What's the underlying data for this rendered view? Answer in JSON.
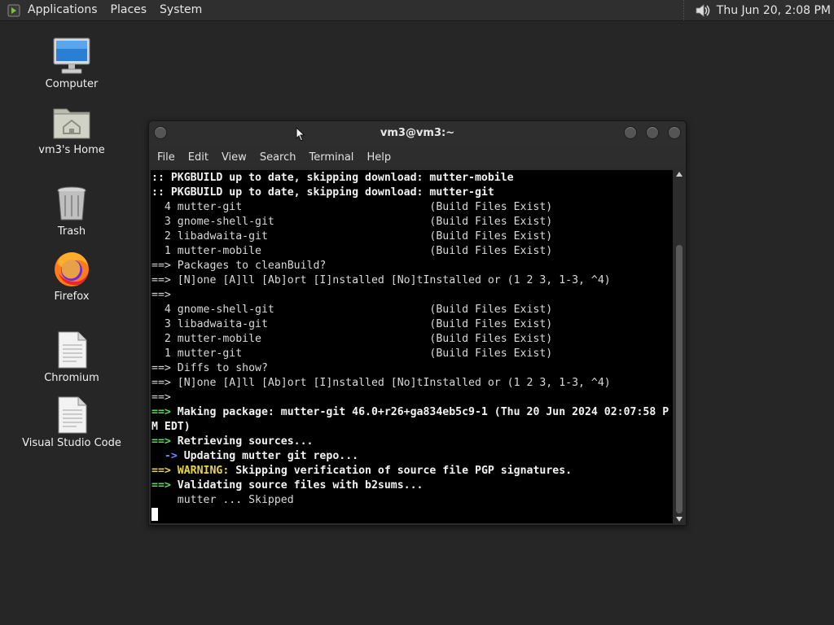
{
  "panel": {
    "menus": [
      "Applications",
      "Places",
      "System"
    ],
    "clock": "Thu Jun 20,  2:08 PM"
  },
  "desktop": {
    "icons": [
      {
        "label": "Computer",
        "icon": "computer-icon"
      },
      {
        "label": "vm3's Home",
        "icon": "home-folder-icon"
      },
      {
        "label": "Trash",
        "icon": "trash-icon"
      },
      {
        "label": "Firefox",
        "icon": "firefox-icon"
      },
      {
        "label": "Chromium",
        "icon": "document-icon"
      },
      {
        "label": "Visual Studio Code",
        "icon": "document-icon"
      }
    ]
  },
  "terminal": {
    "title": "vm3@vm3:~",
    "menus": [
      "File",
      "Edit",
      "View",
      "Search",
      "Terminal",
      "Help"
    ],
    "lines": [
      [
        {
          "t": ":: PKGBUILD up to date, skipping download: mutter-mobile",
          "c": "b"
        }
      ],
      [
        {
          "t": ":: PKGBUILD up to date, skipping download: mutter-git",
          "c": "b"
        }
      ],
      [
        {
          "t": "  4 mutter-git                             (Build Files Exist)",
          "c": ""
        }
      ],
      [
        {
          "t": "  3 gnome-shell-git                        (Build Files Exist)",
          "c": ""
        }
      ],
      [
        {
          "t": "  2 libadwaita-git                         (Build Files Exist)",
          "c": ""
        }
      ],
      [
        {
          "t": "  1 mutter-mobile                          (Build Files Exist)",
          "c": ""
        }
      ],
      [
        {
          "t": "==> Packages to cleanBuild?",
          "c": ""
        }
      ],
      [
        {
          "t": "==> [N]one [A]ll [Ab]ort [I]nstalled [No]tInstalled or (1 2 3, 1-3, ^4)",
          "c": ""
        }
      ],
      [
        {
          "t": "==>",
          "c": ""
        }
      ],
      [
        {
          "t": "  4 gnome-shell-git                        (Build Files Exist)",
          "c": ""
        }
      ],
      [
        {
          "t": "  3 libadwaita-git                         (Build Files Exist)",
          "c": ""
        }
      ],
      [
        {
          "t": "  2 mutter-mobile                          (Build Files Exist)",
          "c": ""
        }
      ],
      [
        {
          "t": "  1 mutter-git                             (Build Files Exist)",
          "c": ""
        }
      ],
      [
        {
          "t": "==> Diffs to show?",
          "c": ""
        }
      ],
      [
        {
          "t": "==> [N]one [A]ll [Ab]ort [I]nstalled [No]tInstalled or (1 2 3, 1-3, ^4)",
          "c": ""
        }
      ],
      [
        {
          "t": "==>",
          "c": ""
        }
      ],
      [
        {
          "t": "==>",
          "c": "g"
        },
        {
          "t": " Making package: mutter-git 46.0+r26+ga834eb5c9-1 (Thu 20 Jun 2024 02:07:58 P",
          "c": "b"
        }
      ],
      [
        {
          "t": "M EDT)",
          "c": "b"
        }
      ],
      [
        {
          "t": "==>",
          "c": "g"
        },
        {
          "t": " Retrieving sources...",
          "c": "b"
        }
      ],
      [
        {
          "t": "  ->",
          "c": "bl"
        },
        {
          "t": " Updating mutter git repo...",
          "c": "b"
        }
      ],
      [
        {
          "t": "==>",
          "c": "y"
        },
        {
          "t": " WARNING:",
          "c": "y"
        },
        {
          "t": " Skipping verification of source file PGP signatures.",
          "c": "b"
        }
      ],
      [
        {
          "t": "==>",
          "c": "g"
        },
        {
          "t": " Validating source files with b2sums...",
          "c": "b"
        }
      ],
      [
        {
          "t": "    mutter ... Skipped",
          "c": ""
        }
      ]
    ]
  },
  "colors": {
    "desktop_bg": "#262626",
    "panel_bg": "#2f2f2f",
    "terminal_bg": "#000000",
    "green": "#5fd75f",
    "blue": "#6f8ef0",
    "yellow": "#e8d44d"
  }
}
